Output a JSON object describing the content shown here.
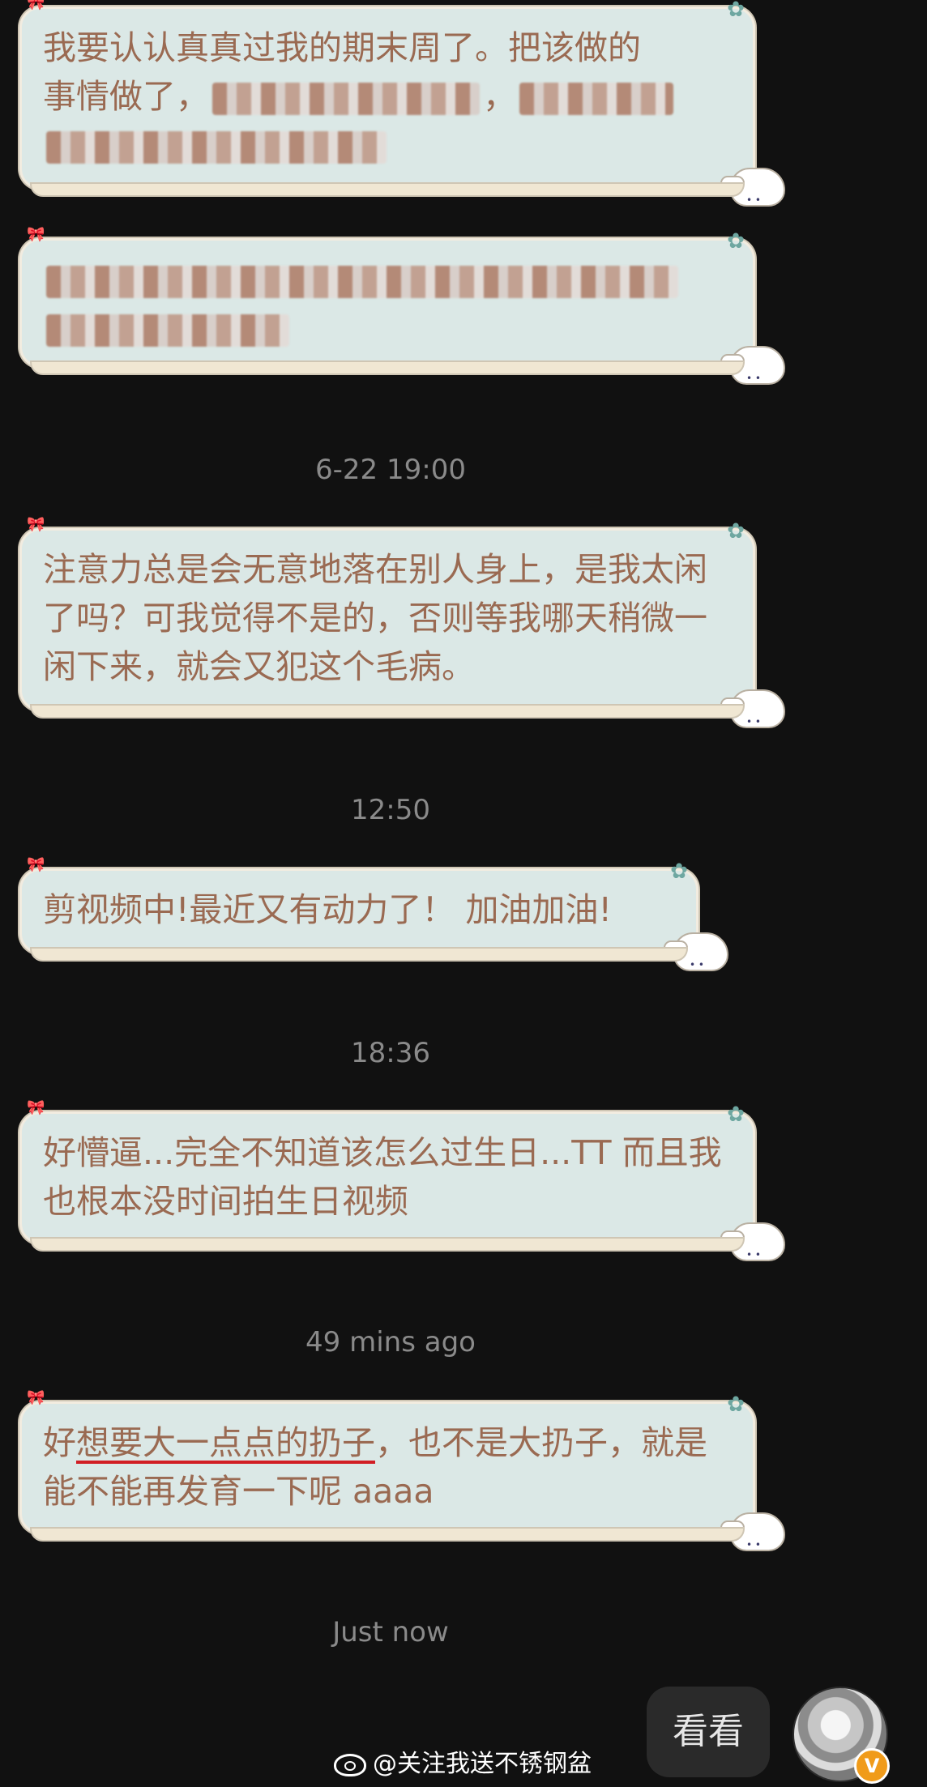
{
  "messages": [
    {
      "line1": "我要认认真真过我的期末周了。把该做的",
      "line2": "事情做了，",
      "line2_tail": "，",
      "line3": ""
    },
    {
      "line1": "",
      "line2": ""
    },
    {
      "timestamp": "6-22 19:00",
      "text": "注意力总是会无意地落在别人身上，是我太闲了吗？可我觉得不是的，否则等我哪天稍微一闲下来，就会又犯这个毛病。"
    },
    {
      "timestamp": "12:50",
      "text": "剪视频中!最近又有动力了！ 加油加油!"
    },
    {
      "timestamp": "18:36",
      "text": "好懵逼...完全不知道该怎么过生日...TT 而且我也根本没时间拍生日视频"
    },
    {
      "timestamp": "49 mins ago",
      "text_pre": "好",
      "text_underlined": "想要大一点点的扔子",
      "text_post": "，也不是大扔子，就是能不能再发育一下呢 aaaa"
    }
  ],
  "reply": {
    "timestamp": "Just now",
    "text": "看看",
    "badge": "V"
  },
  "watermark": {
    "icon": "weibo-icon",
    "text": "@关注我送不锈钢盆"
  },
  "colors": {
    "background": "#111111",
    "bubble_fill": "#dbe8e6",
    "bubble_text": "#9a6a52",
    "timestamp": "#8a8a8a",
    "underline": "#d11e24"
  }
}
